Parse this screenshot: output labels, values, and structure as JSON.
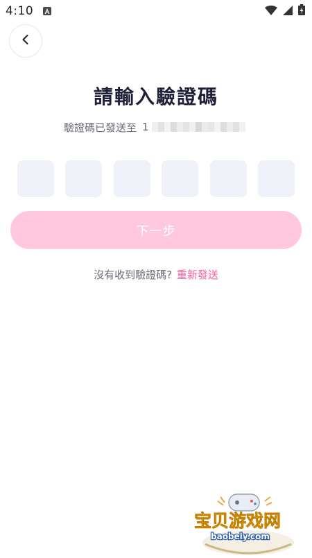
{
  "status_bar": {
    "time": "4:10",
    "icons": [
      "notification-a-icon",
      "wifi-icon",
      "signal-icon",
      "battery-charging-icon"
    ]
  },
  "header": {
    "back_icon": "chevron-left-icon"
  },
  "title": "請輸入驗證碼",
  "sent_to": {
    "label": "驗證碼已發送至",
    "phone_prefix": "1"
  },
  "code_inputs": {
    "count": 6,
    "values": [
      "",
      "",
      "",
      "",
      "",
      ""
    ]
  },
  "next_button": {
    "label": "下一步"
  },
  "resend": {
    "prompt": "沒有收到驗證碼?",
    "link": "重新發送"
  },
  "colors": {
    "accent": "#ff5aa0",
    "button_disabled": "#ffc8de",
    "input_bg": "#eef1f8",
    "title": "#1f1f3a",
    "secondary_text": "#6b6b7b"
  },
  "watermark": {
    "text": "宝贝游戏网",
    "url": "baobeiy.com"
  }
}
